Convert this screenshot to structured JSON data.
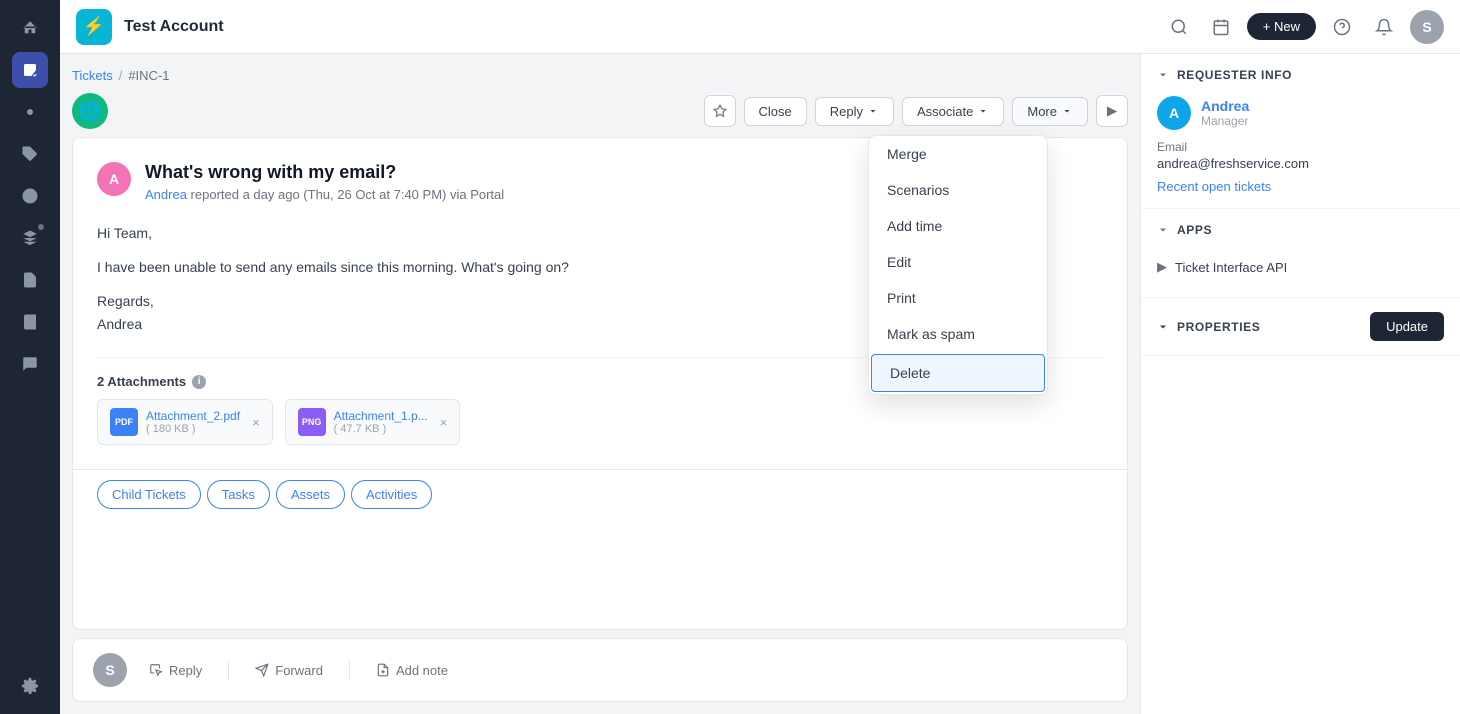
{
  "app": {
    "title": "Test Account",
    "logo_letter": "⚡"
  },
  "topbar": {
    "new_button": "+ New",
    "avatar_letter": "S"
  },
  "breadcrumb": {
    "tickets": "Tickets",
    "separator": "/",
    "current": "#INC-1"
  },
  "ticket": {
    "subject": "What's wrong with my email?",
    "reporter": "Andrea",
    "reported_time": "reported a day ago (Thu, 26 Oct at 7:40 PM) via Portal",
    "body_greeting": "Hi Team,",
    "body_content": "I have been unable to send any emails since this morning. What's going on?",
    "body_regards": "Regards,",
    "body_name": "Andrea",
    "attachments_label": "2 Attachments",
    "attachments": [
      {
        "name": "Attachment_2.pdf",
        "size": "( 180 KB )",
        "type": "PDF"
      },
      {
        "name": "Attachment_1.p...",
        "size": "( 47.7 KB )",
        "type": "PNG"
      }
    ]
  },
  "ticket_actions": {
    "star_title": "Star",
    "close_btn": "Close",
    "reply_btn": "Reply",
    "associate_btn": "Associate",
    "more_btn": "More",
    "arrow_btn": "▶"
  },
  "dropdown_menu": {
    "items": [
      {
        "label": "Merge",
        "highlighted": false
      },
      {
        "label": "Scenarios",
        "highlighted": false
      },
      {
        "label": "Add time",
        "highlighted": false
      },
      {
        "label": "Edit",
        "highlighted": false
      },
      {
        "label": "Print",
        "highlighted": false
      },
      {
        "label": "Mark as spam",
        "highlighted": false
      },
      {
        "label": "Delete",
        "highlighted": true
      }
    ]
  },
  "tabs": {
    "child_tickets": "Child Tickets",
    "tasks": "Tasks",
    "assets": "Assets",
    "activities": "Activities"
  },
  "reply_bar": {
    "reply": "Reply",
    "forward": "Forward",
    "add_note": "Add note"
  },
  "sidebar": {
    "requester_info_title": "REQUESTER INFO",
    "requester_name": "Andrea",
    "requester_role": "Manager",
    "email_label": "Email",
    "email": "andrea@freshservice.com",
    "recent_tickets": "Recent open tickets",
    "apps_title": "APPS",
    "apps_item": "Ticket Interface API",
    "properties_title": "PROPERTIES",
    "update_btn": "Update"
  },
  "rail": {
    "icons": [
      {
        "name": "home-icon",
        "symbol": "⌂"
      },
      {
        "name": "ticket-icon",
        "symbol": "🎫",
        "active": true
      },
      {
        "name": "bug-icon",
        "symbol": "🐛"
      },
      {
        "name": "tag-icon",
        "symbol": "🏷"
      },
      {
        "name": "clock-icon",
        "symbol": "◷"
      },
      {
        "name": "layers-icon",
        "symbol": "⊞"
      },
      {
        "name": "report-icon",
        "symbol": "📊"
      },
      {
        "name": "book-icon",
        "symbol": "📖"
      },
      {
        "name": "chat-icon",
        "symbol": "💬"
      },
      {
        "name": "settings-icon",
        "symbol": "⚙"
      }
    ]
  }
}
